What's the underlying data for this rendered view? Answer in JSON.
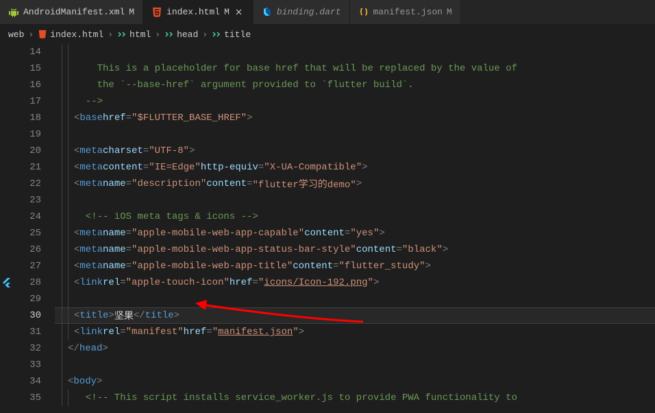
{
  "tabs": [
    {
      "label": "AndroidManifest.xml",
      "modified": "M",
      "icon": "android"
    },
    {
      "label": "index.html",
      "modified": "M",
      "icon": "html",
      "active": true
    },
    {
      "label": "binding.dart",
      "modified": "",
      "icon": "dart",
      "italic": true
    },
    {
      "label": "manifest.json",
      "modified": "M",
      "icon": "json"
    }
  ],
  "breadcrumb": {
    "items": [
      {
        "label": "web",
        "icon": ""
      },
      {
        "label": "index.html",
        "icon": "html"
      },
      {
        "label": "html",
        "icon": "symbol"
      },
      {
        "label": "head",
        "icon": "symbol"
      },
      {
        "label": "title",
        "icon": "symbol"
      }
    ]
  },
  "lines": {
    "start": 14,
    "active": 30,
    "flutter_line": 28
  },
  "code": {
    "l14": "",
    "l15_comment": "    This is a placeholder for base href that will be replaced by the value of",
    "l16_comment": "    the `--base-href` argument provided to `flutter build`.",
    "l17_comment": "  -->",
    "l18": {
      "tag": "base",
      "attr1": "href",
      "val1": "$FLUTTER_BASE_HREF"
    },
    "l19": "",
    "l20": {
      "tag": "meta",
      "attr1": "charset",
      "val1": "UTF-8"
    },
    "l21": {
      "tag": "meta",
      "attr1": "content",
      "val1": "IE=Edge",
      "attr2": "http-equiv",
      "val2": "X-UA-Compatible"
    },
    "l22": {
      "tag": "meta",
      "attr1": "name",
      "val1": "description",
      "attr2": "content",
      "val2": "flutter学习的demo"
    },
    "l23": "",
    "l24_comment": "  <!-- iOS meta tags & icons -->",
    "l25": {
      "tag": "meta",
      "attr1": "name",
      "val1": "apple-mobile-web-app-capable",
      "attr2": "content",
      "val2": "yes"
    },
    "l26": {
      "tag": "meta",
      "attr1": "name",
      "val1": "apple-mobile-web-app-status-bar-style",
      "attr2": "content",
      "val2": "black"
    },
    "l27": {
      "tag": "meta",
      "attr1": "name",
      "val1": "apple-mobile-web-app-title",
      "attr2": "content",
      "val2": "flutter_study"
    },
    "l28": {
      "tag": "link",
      "attr1": "rel",
      "val1": "apple-touch-icon",
      "attr2": "href",
      "val2": "icons/Icon-192.png"
    },
    "l29": "",
    "l30": {
      "tag": "title",
      "text": "坚果"
    },
    "l31": {
      "tag": "link",
      "attr1": "rel",
      "val1": "manifest",
      "attr2": "href",
      "val2": "manifest.json"
    },
    "l32": {
      "close_tag": "head"
    },
    "l33": "",
    "l34": {
      "open_tag": "body"
    },
    "l35_comment": "  <!-- This script installs service_worker.js to provide PWA functionality to"
  }
}
